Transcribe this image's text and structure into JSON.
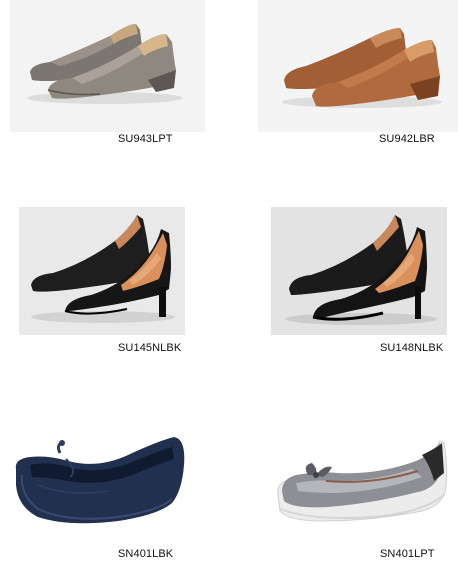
{
  "products": [
    {
      "code": "SU943LPT",
      "image": "grey-metallic-wedge-pumps"
    },
    {
      "code": "SU942LBR",
      "image": "tan-leather-wedge-pumps"
    },
    {
      "code": "SU145NLBK",
      "image": "black-leather-heel-pumps"
    },
    {
      "code": "SU148NLBK",
      "image": "black-leather-platform-pumps"
    },
    {
      "code": "SN401LBK",
      "image": "navy-ballet-flat"
    },
    {
      "code": "SN401LPT",
      "image": "pewter-bow-sneaker-flat"
    }
  ],
  "colors": {
    "pewter": "#8a847e",
    "tan": "#b06a3e",
    "black": "#161616",
    "lining": "#d9905a",
    "navy": "#22304f",
    "silver": "#8d8f95",
    "sole_white": "#ededed"
  }
}
